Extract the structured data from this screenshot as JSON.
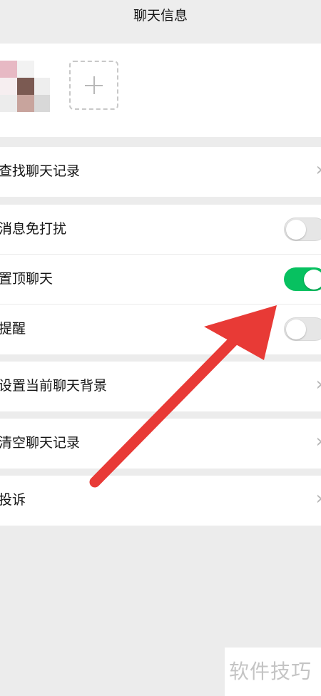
{
  "header": {
    "title": "聊天信息",
    "back_icon": "‹"
  },
  "members": {
    "avatar_icon": "avatar",
    "add_button_icon": "plus-icon"
  },
  "groups": [
    {
      "rows": [
        {
          "label": "查找聊天记录",
          "type": "link"
        }
      ]
    },
    {
      "rows": [
        {
          "label": "消息免打扰",
          "type": "toggle",
          "on": false
        },
        {
          "label": "置顶聊天",
          "type": "toggle",
          "on": true
        },
        {
          "label": "提醒",
          "type": "toggle",
          "on": false
        }
      ]
    },
    {
      "rows": [
        {
          "label": "设置当前聊天背景",
          "type": "link"
        }
      ]
    },
    {
      "rows": [
        {
          "label": "清空聊天记录",
          "type": "link"
        }
      ]
    },
    {
      "rows": [
        {
          "label": "投诉",
          "type": "link"
        }
      ]
    }
  ],
  "chevron": "›",
  "colors": {
    "toggle_on": "#07c160",
    "toggle_off": "#e6e6e6",
    "annotation_arrow": "#e83a36"
  },
  "watermark": {
    "text": "软件技巧"
  }
}
